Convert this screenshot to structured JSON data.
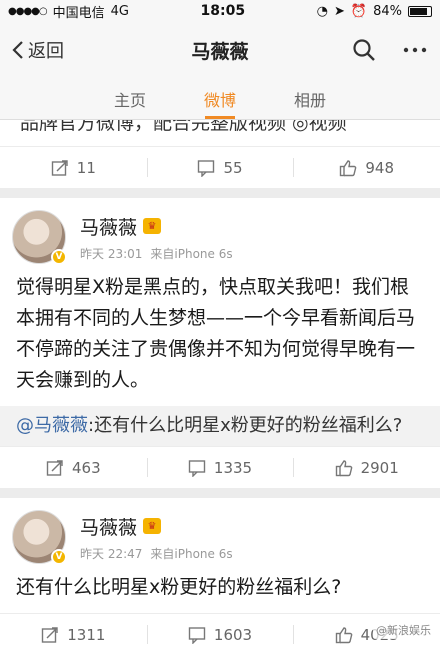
{
  "status_bar": {
    "carrier": "中国电信",
    "network": "4G",
    "time": "18:05",
    "battery": "84%"
  },
  "nav": {
    "back_label": "返回",
    "title": "马薇薇"
  },
  "tabs": [
    {
      "label": "主页",
      "active": false
    },
    {
      "label": "微博",
      "active": true
    },
    {
      "label": "相册",
      "active": false
    }
  ],
  "prev_post": {
    "fragment_text": "品牌官方微博，配合完整版视频 ◎视频",
    "actions": {
      "repost": "11",
      "comment": "55",
      "like": "948"
    }
  },
  "posts": [
    {
      "name": "马薇薇",
      "time": "昨天 23:01",
      "source": "来自iPhone 6s",
      "text": "觉得明星X粉是黑点的，快点取关我吧！我们根本拥有不同的人生梦想——一个今早看新闻后马不停蹄的关注了贵偶像并不知为何觉得早晚有一天会赚到的人。",
      "quote_mention": "@马薇薇",
      "quote_text": ":还有什么比明星x粉更好的粉丝福利么?",
      "actions": {
        "repost": "463",
        "comment": "1335",
        "like": "2901"
      }
    },
    {
      "name": "马薇薇",
      "time": "昨天 22:47",
      "source": "来自iPhone 6s",
      "text": "还有什么比明星x粉更好的粉丝福利么?",
      "actions": {
        "repost": "1311",
        "comment": "1603",
        "like": "4025"
      }
    }
  ],
  "watermark": "@新浪娱乐",
  "colors": {
    "accent": "#f08a24",
    "link": "#3d6aa6",
    "verified": "#f3b600"
  },
  "icons": [
    "back-chevron-icon",
    "search-icon",
    "more-icon",
    "repost-icon",
    "comment-icon",
    "like-icon"
  ]
}
